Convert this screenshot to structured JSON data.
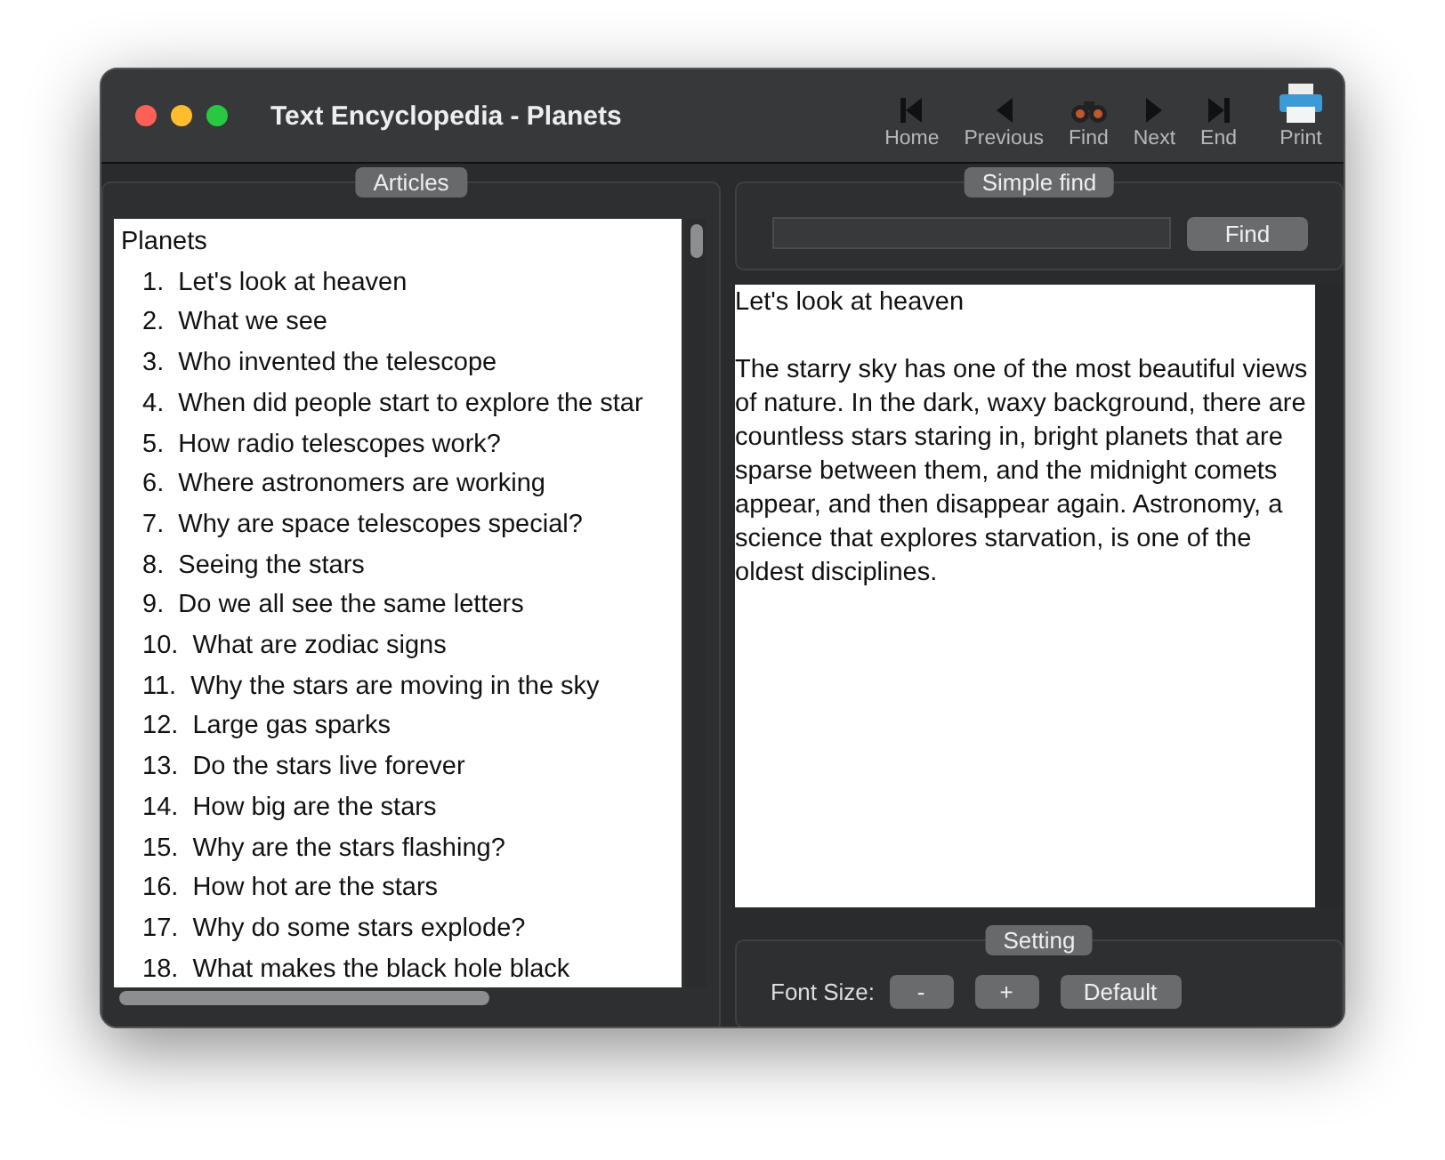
{
  "window": {
    "title": "Text Encyclopedia - Planets"
  },
  "toolbar": [
    {
      "kind": "home",
      "label": "Home"
    },
    {
      "kind": "previous",
      "label": "Previous"
    },
    {
      "kind": "find",
      "label": "Find"
    },
    {
      "kind": "next",
      "label": "Next"
    },
    {
      "kind": "end",
      "label": "End"
    },
    {
      "kind": "print",
      "label": "Print"
    }
  ],
  "articles": {
    "legend": "Articles",
    "root": "Planets",
    "items": [
      "1.  Let's look at heaven",
      "2.  What we see",
      "3.  Who invented the telescope",
      "4.  When did people start to explore the star",
      "5.  How radio telescopes work?",
      "6.  Where astronomers are working",
      "7.  Why are space telescopes special?",
      "8.  Seeing the stars",
      "9.  Do we all see the same letters",
      "10.  What are zodiac signs",
      "11.  Why the stars are moving in the sky",
      "12.  Large gas sparks",
      "13.  Do the stars live forever",
      "14.  How big are the stars",
      "15.  Why are the stars flashing?",
      "16.  How hot are the stars",
      "17.  Why do some stars explode?",
      "18.  What makes the black hole black"
    ]
  },
  "simple_find": {
    "legend": "Simple find",
    "button": "Find"
  },
  "article_view": {
    "heading": "Let's look at heaven",
    "body": "The starry sky has one of the most beautiful views of nature. In the dark, waxy background, there are countless stars staring in, bright planets that are sparse between them, and the midnight comets appear, and then disappear again. Astronomy, a science that explores starvation, is one of the oldest disciplines."
  },
  "setting": {
    "legend": "Setting",
    "label": "Font Size:",
    "buttons": [
      "-",
      "+",
      "Default"
    ]
  }
}
